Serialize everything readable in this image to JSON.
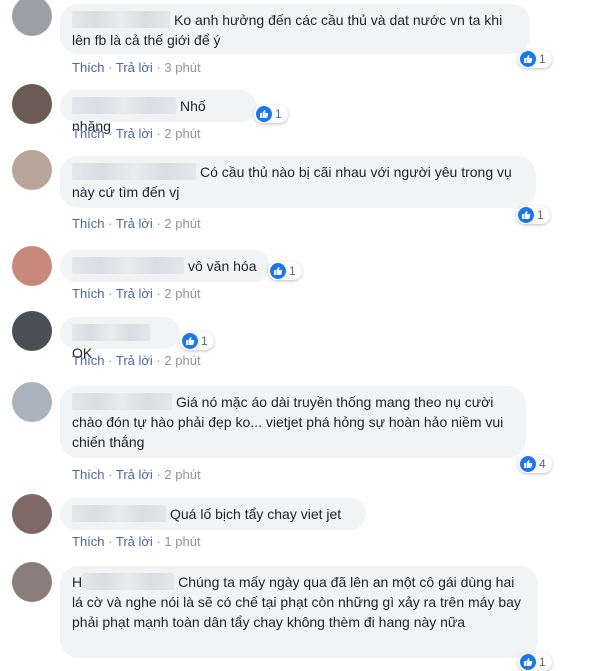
{
  "comments": [
    {
      "text": "Ko anh hưởng đến các cầu thủ và dat nước vn ta khi lên fb là cả thế giới để ý",
      "likes": "1",
      "like_label": "Thích",
      "reply_label": "Trả lời",
      "time": "3 phút",
      "avatar_color": "#9aa0a8"
    },
    {
      "text": "Nhố nhăng",
      "likes": "1",
      "like_label": "Thích",
      "reply_label": "Trả lời",
      "time": "2 phút",
      "avatar_color": "#6b5b55"
    },
    {
      "text": "Có cầu thủ nào bị cãi nhau với người yêu trong vụ này cứ tìm đến vj",
      "likes": "1",
      "like_label": "Thích",
      "reply_label": "Trả lời",
      "time": "2 phút",
      "avatar_color": "#b9a49a"
    },
    {
      "text": "vô văn hóa",
      "likes": "1",
      "like_label": "Thích",
      "reply_label": "Trả lời",
      "time": "2 phút",
      "avatar_color": "#c8887a"
    },
    {
      "text": "OK",
      "likes": "1",
      "like_label": "Thích",
      "reply_label": "Trả lời",
      "time": "2 phút",
      "avatar_color": "#4a4e55"
    },
    {
      "text": "Giá nó mặc áo dài truyền thống mang theo nụ cười chào đón tự hào phải đẹp ko... vietjet phá hỏng sự hoàn hảo niềm vui chiến thắng",
      "likes": "4",
      "like_label": "Thích",
      "reply_label": "Trả lời",
      "time": "2 phút",
      "avatar_color": "#a9b3bd"
    },
    {
      "text": "Quá lố bịch tẩy chay viet jet",
      "likes": "",
      "like_label": "Thích",
      "reply_label": "Trả lời",
      "time": "1 phút",
      "avatar_color": "#7d6a66"
    },
    {
      "text": "Chúng ta mấy ngày qua đã lên an một cô gái dùng hai lá cờ và nghe nói là sẽ có chế tại phạt còn những gì xảy ra trên máy bay phải phạt mạnh toàn dân tẩy chay không thèm đi hang này nữa",
      "name_visible": "H",
      "likes": "1",
      "like_label": "",
      "reply_label": "",
      "time": "",
      "avatar_color": "#8b7e7a"
    }
  ],
  "separator": "·",
  "accent": "#1877f2"
}
